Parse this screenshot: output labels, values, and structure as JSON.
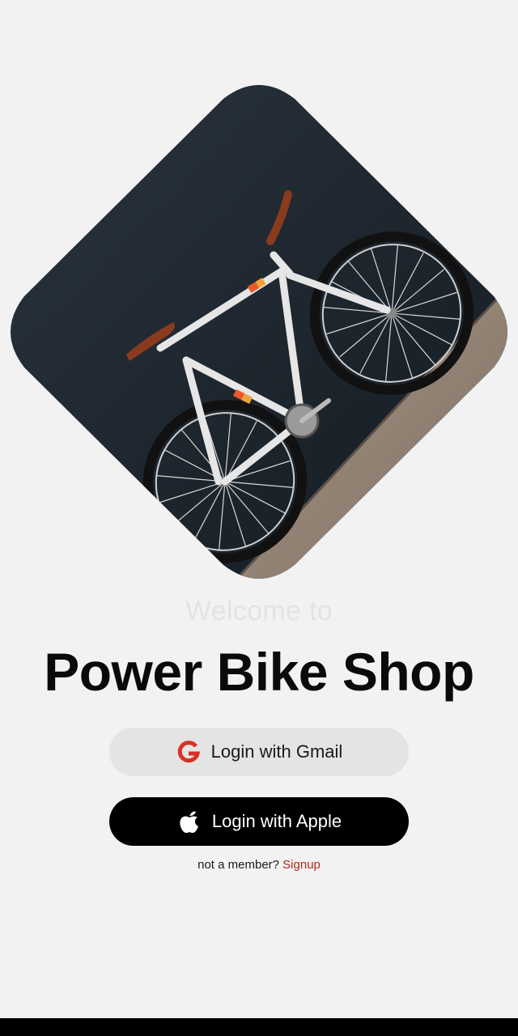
{
  "hero": {
    "image_alt": "white fixed-gear bicycle leaning against a dark wall"
  },
  "welcome_text": "Welcome to",
  "app_title": "Power Bike Shop",
  "buttons": {
    "gmail_label": "Login with Gmail",
    "apple_label": "Login with Apple"
  },
  "signup": {
    "prompt": "not a member?",
    "link_label": "Signup"
  },
  "colors": {
    "background": "#f2f2f2",
    "gmail_icon": "#d93025",
    "signup_link": "#b3261e",
    "apple_button": "#000000",
    "gmail_button": "#e4e4e4"
  },
  "icons": {
    "gmail": "google-g-icon",
    "apple": "apple-logo-icon"
  }
}
